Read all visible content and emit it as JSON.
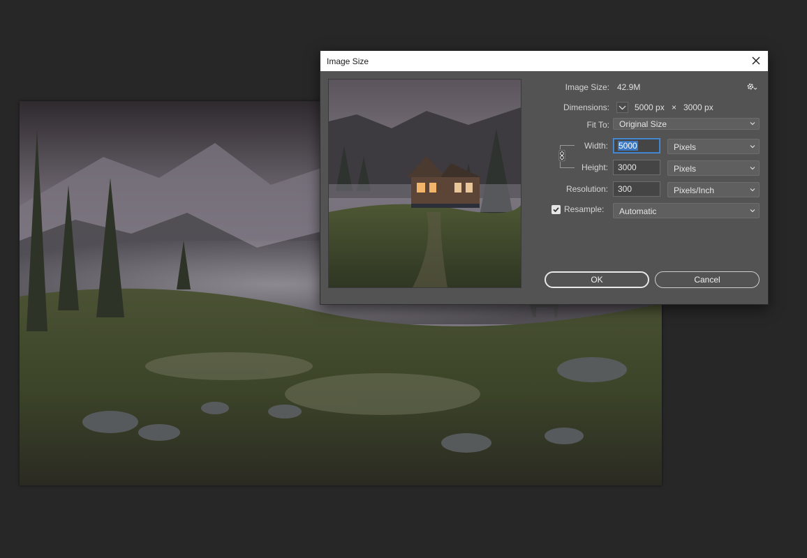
{
  "dialog": {
    "title": "Image Size",
    "image_size_label": "Image Size:",
    "image_size_value": "42.9M",
    "dimensions_label": "Dimensions:",
    "dimensions_width": "5000 px",
    "dimensions_sep": "×",
    "dimensions_height": "3000 px",
    "fit_to_label": "Fit To:",
    "fit_to_value": "Original Size",
    "width_label": "Width:",
    "width_value": "5000",
    "width_unit": "Pixels",
    "height_label": "Height:",
    "height_value": "3000",
    "height_unit": "Pixels",
    "resolution_label": "Resolution:",
    "resolution_value": "300",
    "resolution_unit": "Pixels/Inch",
    "resample_label": "Resample:",
    "resample_checked": true,
    "resample_value": "Automatic",
    "ok_label": "OK",
    "cancel_label": "Cancel"
  },
  "icons": {
    "close": "close-icon",
    "gear": "gear-icon",
    "chevron": "chevron-down-icon",
    "link": "chain-link-icon",
    "check": "checkmark-icon"
  },
  "colors": {
    "app_background": "#272727",
    "dialog_background": "#535353",
    "titlebar_background": "#ffffff",
    "focus_blue": "#3d79c3"
  }
}
